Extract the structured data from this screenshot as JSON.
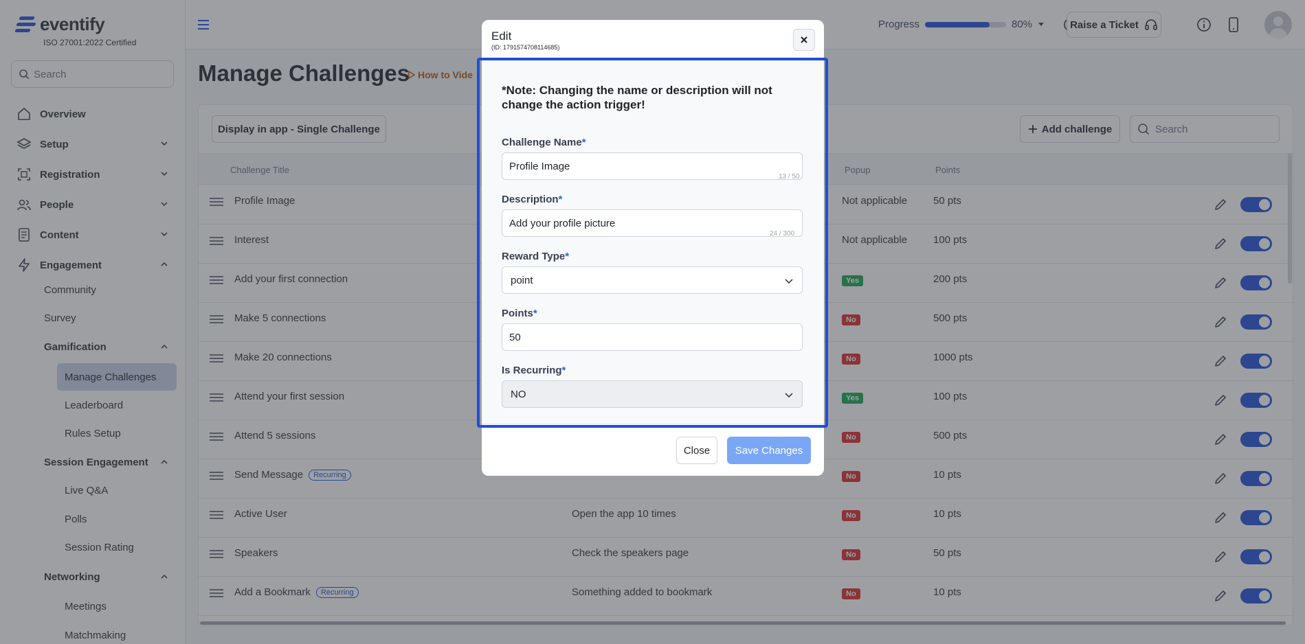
{
  "brand": {
    "name": "eventify",
    "certification": "ISO 27001:2022 Certified"
  },
  "sidebar": {
    "search_placeholder": "Search",
    "items": [
      {
        "label": "Overview"
      },
      {
        "label": "Setup"
      },
      {
        "label": "Registration"
      },
      {
        "label": "People"
      },
      {
        "label": "Content"
      },
      {
        "label": "Engagement"
      }
    ],
    "engagement": {
      "community": "Community",
      "survey": "Survey",
      "gamification": "Gamification",
      "manage_challenges": "Manage Challenges",
      "leaderboard": "Leaderboard",
      "rules_setup": "Rules Setup",
      "session_engagement": "Session Engagement",
      "live_qa": "Live Q&A",
      "polls": "Polls",
      "session_rating": "Session Rating",
      "networking": "Networking",
      "meetings": "Meetings",
      "matchmaking": "Matchmaking"
    }
  },
  "topbar": {
    "progress_label": "Progress",
    "progress_value": 80,
    "progress_text": "80%",
    "ticket_label": "Raise a Ticket"
  },
  "main": {
    "title": "Manage Challenges",
    "how_to": "How to Vide",
    "display_btn": "Display in app - Single Challenge",
    "add_btn": "Add challenge",
    "search_placeholder": "Search",
    "columns": {
      "title": "Challenge Title",
      "popup": "Popup",
      "points": "Points"
    },
    "rows": [
      {
        "title": "Profile Image",
        "recurring": false,
        "desc": "",
        "popup": "Not applicable",
        "popup_type": "text",
        "points": "50 pts"
      },
      {
        "title": "Interest",
        "recurring": false,
        "desc": "",
        "popup": "Not applicable",
        "popup_type": "text",
        "points": "100 pts"
      },
      {
        "title": "Add your first connection",
        "recurring": false,
        "desc": "",
        "popup": "Yes",
        "popup_type": "yes",
        "points": "200 pts"
      },
      {
        "title": "Make 5 connections",
        "recurring": false,
        "desc": "",
        "popup": "No",
        "popup_type": "no",
        "points": "500 pts"
      },
      {
        "title": "Make 20 connections",
        "recurring": false,
        "desc": "",
        "popup": "No",
        "popup_type": "no",
        "points": "1000 pts"
      },
      {
        "title": "Attend your first session",
        "recurring": false,
        "desc": "",
        "popup": "Yes",
        "popup_type": "yes",
        "points": "100 pts"
      },
      {
        "title": "Attend 5 sessions",
        "recurring": false,
        "desc": "",
        "popup": "No",
        "popup_type": "no",
        "points": "500 pts"
      },
      {
        "title": "Send Message",
        "recurring": true,
        "desc": "",
        "popup": "No",
        "popup_type": "no",
        "points": "10 pts"
      },
      {
        "title": "Active User",
        "recurring": false,
        "desc": "Open the app 10 times",
        "popup": "No",
        "popup_type": "no",
        "points": "10 pts"
      },
      {
        "title": "Speakers",
        "recurring": false,
        "desc": "Check the speakers page",
        "popup": "No",
        "popup_type": "no",
        "points": "50 pts"
      },
      {
        "title": "Add a Bookmark",
        "recurring": true,
        "desc": "Something added to bookmark",
        "popup": "No",
        "popup_type": "no",
        "points": "10 pts"
      }
    ],
    "recurring_label": "Recurring"
  },
  "modal": {
    "title": "Edit",
    "id_text": "(ID: 1791574708114685)",
    "note": "*Note: Changing the name or description will not change the action trigger!",
    "name_label": "Challenge Name",
    "name_value": "Profile Image",
    "name_count": "13 / 50",
    "desc_label": "Description",
    "desc_value": "Add your profile picture",
    "desc_count": "24 / 300",
    "reward_label": "Reward Type",
    "reward_value": "point",
    "points_label": "Points",
    "points_value": "50",
    "recurring_label": "Is Recurring",
    "recurring_value": "NO",
    "required_mark": "*",
    "close_btn": "Close",
    "save_btn": "Save Changes"
  },
  "colors": {
    "accent": "#1d4ed8",
    "yes": "#16a34a",
    "no": "#dc2626",
    "save_disabled": "#7aa7f5"
  }
}
